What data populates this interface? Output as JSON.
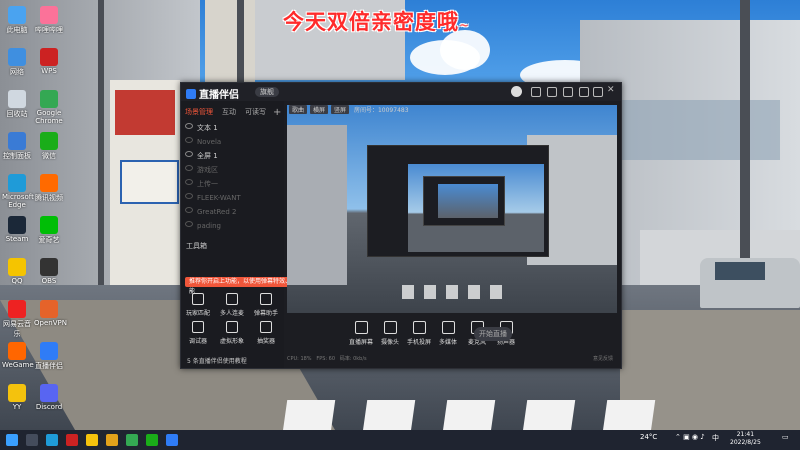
{
  "overlay": {
    "headline": "今天双倍亲密度哦",
    "tail": "~"
  },
  "desktop_icons": [
    {
      "label": "此电脑",
      "color": "#4aa3f0"
    },
    {
      "label": "网络",
      "color": "#3f8fe0"
    },
    {
      "label": "回收站",
      "color": "#d0d8e0"
    },
    {
      "label": "控制面板",
      "color": "#3a7bd5"
    },
    {
      "label": "Microsoft Edge",
      "color": "#1f9bd8"
    },
    {
      "label": "Steam",
      "color": "#1b2838"
    },
    {
      "label": "QQ",
      "color": "#f5c400"
    },
    {
      "label": "网易云音乐",
      "color": "#e22"
    },
    {
      "label": "WeGame",
      "color": "#f60"
    },
    {
      "label": "YY",
      "color": "#f4c20d"
    },
    {
      "label": "哔哩哔哩",
      "color": "#fb7299"
    },
    {
      "label": "WPS",
      "color": "#c22"
    },
    {
      "label": "Google Chrome",
      "color": "#34a853"
    },
    {
      "label": "微信",
      "color": "#1aad19"
    },
    {
      "label": "腾讯视频",
      "color": "#ff6a00"
    },
    {
      "label": "爱奇艺",
      "color": "#00be06"
    },
    {
      "label": "OBS",
      "color": "#333"
    },
    {
      "label": "OpenVPN",
      "color": "#e5632a"
    },
    {
      "label": "直播伴侣",
      "color": "#2f7cf6"
    },
    {
      "label": "Discord",
      "color": "#5865f2"
    }
  ],
  "app": {
    "name": "直播伴侣",
    "version": "旗舰",
    "left_tabs": [
      "场景管理",
      "互动",
      "可读写"
    ],
    "scenes": [
      {
        "name": "文本 1",
        "dim": false
      },
      {
        "name": "Novela",
        "dim": true
      },
      {
        "name": "全屏 1",
        "dim": false
      },
      {
        "name": "游戏区",
        "dim": true
      },
      {
        "name": "上传一",
        "dim": true
      },
      {
        "name": "FLEEK-WANT",
        "dim": true
      },
      {
        "name": "GreatRed 2",
        "dim": true
      },
      {
        "name": "pading",
        "dim": true
      }
    ],
    "tools_title": "工具箱",
    "notice": "推荐你开启上功能，以使用弹幕特效、展示情绪包等个功能",
    "tools": [
      "玩家匹配",
      "多人连麦",
      "弹幕助手",
      "调试器",
      "虚拟形象",
      "抽奖器"
    ],
    "bottom_tip": "5 条直播伴侣使用教程",
    "preview_info": {
      "tag1": "歌曲",
      "tag2": "横屏",
      "tag3": "竖屏",
      "room_label": "房间号：",
      "room": "10097483"
    },
    "controls": [
      "直播屏幕",
      "摄像头",
      "手机投屏",
      "多媒体",
      "麦克风",
      "扬声器"
    ],
    "start_button": "开始直播",
    "status": {
      "cpu": "CPU: 18%",
      "fps": "FPS: 60",
      "bitrate": "码率: 0kb/s",
      "feedback": "意见反馈"
    }
  },
  "taskbar": {
    "weather": "24°C",
    "ime": "中",
    "time": "21:41",
    "date": "2022/8/25"
  }
}
